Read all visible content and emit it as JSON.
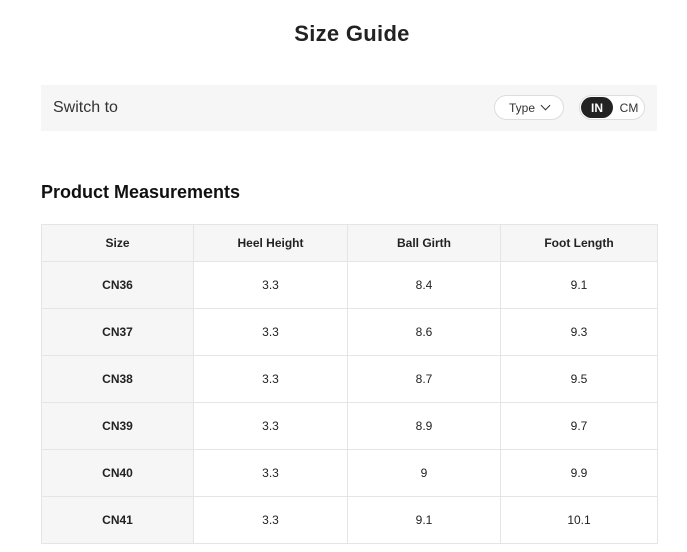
{
  "page_title": "Size Guide",
  "switch_bar": {
    "label": "Switch to",
    "type_select": {
      "label": "Type",
      "icon": "chevron-down-icon"
    },
    "unit_toggle": {
      "options": [
        "IN",
        "CM"
      ],
      "selected": "IN"
    }
  },
  "section_title": "Product Measurements",
  "table": {
    "headers": [
      "Size",
      "Heel Height",
      "Ball Girth",
      "Foot Length"
    ],
    "rows": [
      [
        "CN36",
        "3.3",
        "8.4",
        "9.1"
      ],
      [
        "CN37",
        "3.3",
        "8.6",
        "9.3"
      ],
      [
        "CN38",
        "3.3",
        "8.7",
        "9.5"
      ],
      [
        "CN39",
        "3.3",
        "8.9",
        "9.7"
      ],
      [
        "CN40",
        "3.3",
        "9",
        "9.9"
      ],
      [
        "CN41",
        "3.3",
        "9.1",
        "10.1"
      ]
    ]
  }
}
